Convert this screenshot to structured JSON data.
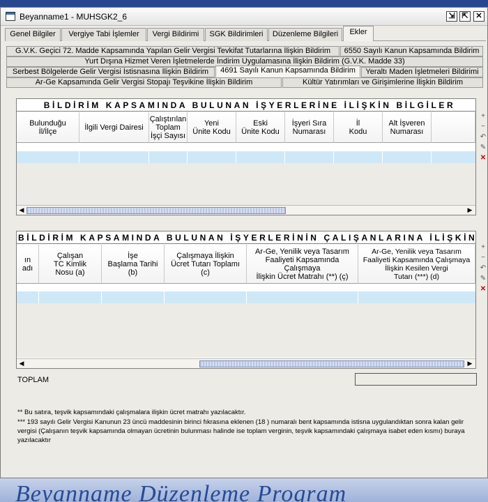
{
  "window": {
    "title": "Beyanname1 - MUHSGK2_6"
  },
  "main_tabs": [
    {
      "label": "Genel Bilgiler",
      "active": false
    },
    {
      "label": "Vergiye Tabi İşlemler",
      "active": false
    },
    {
      "label": "Vergi Bildirimi",
      "active": false
    },
    {
      "label": "SGK Bildirimleri",
      "active": false
    },
    {
      "label": "Düzenleme Bilgileri",
      "active": false
    },
    {
      "label": "Ekler",
      "active": true
    }
  ],
  "sub_tabs": [
    {
      "label": "G.V.K. Geçici 72. Madde Kapsamında Yapılan Gelir Vergisi Tevkifat Tutarlarına İlişkin Bildirim"
    },
    {
      "label": "6550 Sayılı Kanun Kapsamında Bildirim"
    },
    {
      "label": "Yurt Dışına Hizmet Veren İşletmelerde İndirim Uygulamasına İlişkin Bildirim (G.V.K. Madde 33)"
    },
    {
      "label": "Serbest Bölgelerde Gelir Vergisi İstisnasına İlişkin Bildirim"
    },
    {
      "label": "4691 Sayılı Kanun Kapsamında Bildirim"
    },
    {
      "label": "Yeraltı Maden İşletmeleri Bildirimi"
    },
    {
      "label": "Ar-Ge Kapsamında Gelir Vergisi Stopajı Teşvikine İlişkin Bildirim"
    },
    {
      "label": "Kültür Yatırımları ve Girişimlerine İlişkin Bildirim"
    }
  ],
  "grid1": {
    "title": "BİLDİRİM KAPSAMINDA BULUNAN İŞYERLERİNE İLİŞKİN BİLGİLER",
    "columns": [
      "Bulunduğu\nİl/İlçe",
      "İlgili Vergi Dairesi",
      "Çalıştırılan\nToplam\nİşçi Sayısı",
      "Yeni\nÜnite Kodu",
      "Eski\nÜnite Kodu",
      "İşyeri Sıra\nNumarası",
      "İl\nKodu",
      "Alt İşveren\nNumarası"
    ]
  },
  "grid2": {
    "title": "BİLDİRİM KAPSAMINDA BULUNAN İŞYERLERİNİN ÇALIŞANLARINA İLİŞKİN BİLGİLER",
    "columns": [
      "ın\nadı",
      "Çalışan\nTC Kimlik\nNosu (a)",
      "İşe\nBaşlama Tarihi (b)",
      "Çalışmaya İlişkin\nÜcret Tutarı Toplamı (c)",
      "Ar-Ge, Yenilik veya Tasarım\nFaaliyeti Kapsamında Çalışmaya\nİlişkin Ücret Matrahı (**) (ç)",
      "Ar-Ge, Yenilik veya Tasarım\nFaaliyeti Kapsamında Çalışmaya\nİlişkin Kesilen Vergi\nTutarı (***) (d)"
    ]
  },
  "total": {
    "label": "TOPLAM",
    "value": ""
  },
  "notes": {
    "n1": "** Bu satıra, teşvik kapsamındaki çalışmalara ilişkin ücret matrahı yazılacaktır.",
    "n2": "*** 193 sayılı Gelir Vergisi Kanunun 23 üncü maddesinin birinci fıkrasına eklenen (18 ) numaralı bent kapsamında istisna uygulandıktan sonra kalan gelir vergisi (Çalışanın teşvik kapsamında olmayan ücretinin bulunması halinde ise toplam verginin, teşvik kapsamındaki çalışmaya isabet eden kısmı) buraya yazılacaktır"
  },
  "background_text": "Beyanname Düzenleme Program"
}
